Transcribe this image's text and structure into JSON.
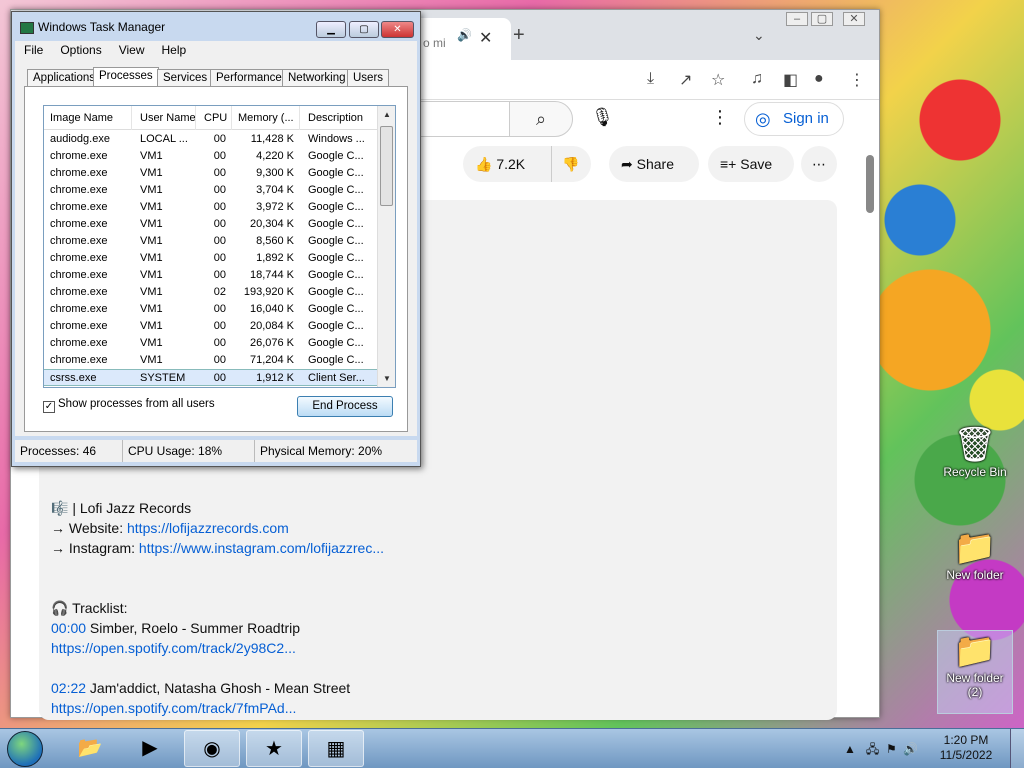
{
  "desktop": {
    "icons": [
      {
        "label": "Recycle Bin",
        "icon": "recycle-bin-icon"
      },
      {
        "label": "New folder",
        "icon": "folder-icon"
      },
      {
        "label": "New folder (2)",
        "icon": "folder-icon"
      }
    ]
  },
  "chrome": {
    "tab_label": "o mi",
    "new_tab": "+",
    "like_count": "7.2K",
    "share_label": "Share",
    "save_label": "Save",
    "signin_label": "Sign in"
  },
  "description": {
    "line1": "🎼 | Lofi Jazz Records",
    "website_prefix": "→ Website: ",
    "website_url": "https://lofijazzrecords.com",
    "instagram_prefix": "→ Instagram: ",
    "instagram_url": "https://www.instagram.com/lofijazzrec...",
    "tracklist": "🎧 Tracklist:",
    "t1_time": "00:00",
    "t1_name": " Simber, Roelo - Summer Roadtrip",
    "t1_url": "https://open.spotify.com/track/2y98C2...",
    "t2_time": "02:22",
    "t2_name": " Jam'addict, Natasha Ghosh - Mean Street",
    "t2_url": "https://open.spotify.com/track/7fmPAd..."
  },
  "taskmanager": {
    "title": "Windows Task Manager",
    "menu": [
      "File",
      "Options",
      "View",
      "Help"
    ],
    "tabs": [
      "Applications",
      "Processes",
      "Services",
      "Performance",
      "Networking",
      "Users"
    ],
    "columns": [
      "Image Name",
      "User Name",
      "CPU",
      "Memory (...",
      "Description"
    ],
    "rows": [
      [
        "audiodg.exe",
        "LOCAL ...",
        "00",
        "11,428 K",
        "Windows ..."
      ],
      [
        "chrome.exe",
        "VM1",
        "00",
        "4,220 K",
        "Google C..."
      ],
      [
        "chrome.exe",
        "VM1",
        "00",
        "9,300 K",
        "Google C..."
      ],
      [
        "chrome.exe",
        "VM1",
        "00",
        "3,704 K",
        "Google C..."
      ],
      [
        "chrome.exe",
        "VM1",
        "00",
        "3,972 K",
        "Google C..."
      ],
      [
        "chrome.exe",
        "VM1",
        "00",
        "20,304 K",
        "Google C..."
      ],
      [
        "chrome.exe",
        "VM1",
        "00",
        "8,560 K",
        "Google C..."
      ],
      [
        "chrome.exe",
        "VM1",
        "00",
        "1,892 K",
        "Google C..."
      ],
      [
        "chrome.exe",
        "VM1",
        "00",
        "18,744 K",
        "Google C..."
      ],
      [
        "chrome.exe",
        "VM1",
        "02",
        "193,920 K",
        "Google C..."
      ],
      [
        "chrome.exe",
        "VM1",
        "00",
        "16,040 K",
        "Google C..."
      ],
      [
        "chrome.exe",
        "VM1",
        "00",
        "20,084 K",
        "Google C..."
      ],
      [
        "chrome.exe",
        "VM1",
        "00",
        "26,076 K",
        "Google C..."
      ],
      [
        "chrome.exe",
        "VM1",
        "00",
        "71,204 K",
        "Google C..."
      ],
      [
        "csrss.exe",
        "SYSTEM",
        "00",
        "1,912 K",
        "Client Ser..."
      ]
    ],
    "show_all_label": "Show processes from all users",
    "show_all_checked": "✓",
    "end_process_label": "End Process",
    "status_processes": "Processes: 46",
    "status_cpu": "CPU Usage: 18%",
    "status_memory": "Physical Memory: 20%"
  },
  "taskbar": {
    "time": "1:20 PM",
    "date": "11/5/2022"
  }
}
